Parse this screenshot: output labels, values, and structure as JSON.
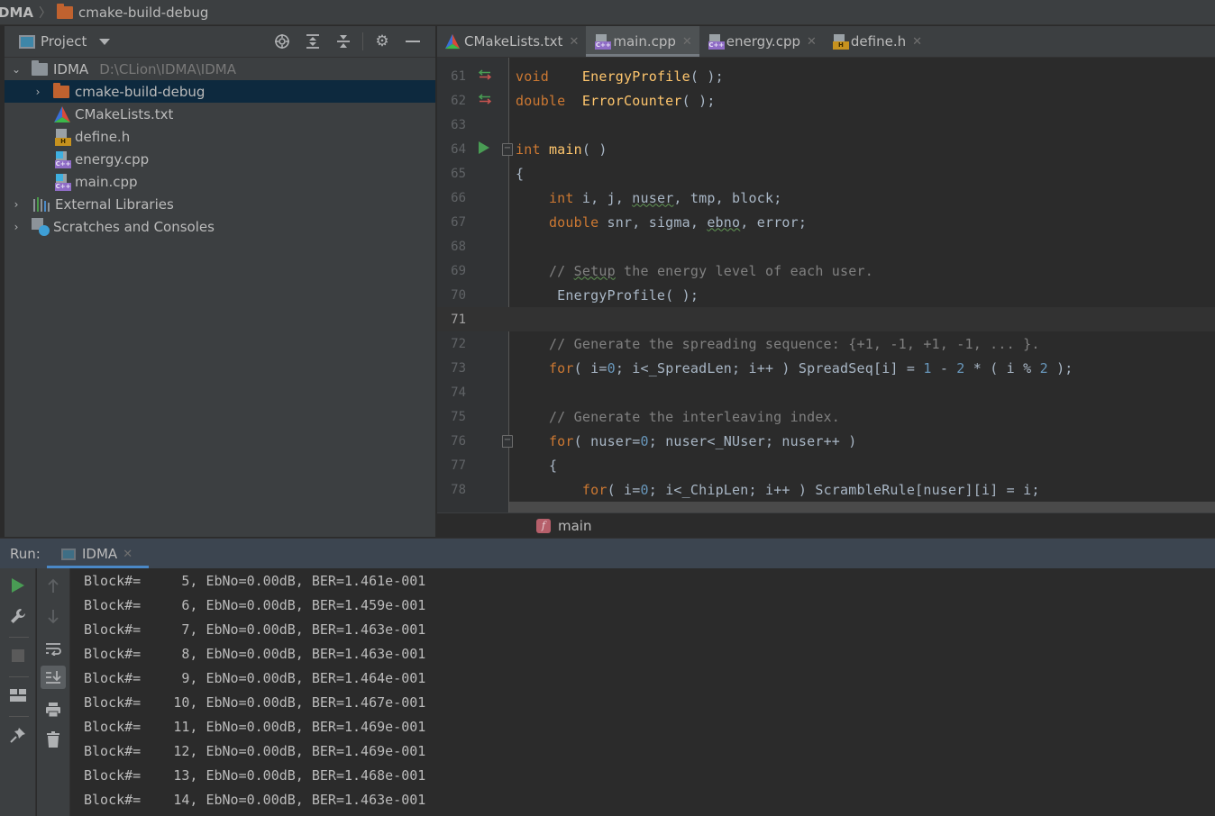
{
  "navbar": {
    "root": "DMA",
    "folder": "cmake-build-debug"
  },
  "project_panel": {
    "title": "Project",
    "tools": [
      "locate-icon",
      "expand-all-icon",
      "collapse-all-icon",
      "gear-icon",
      "minimize-icon"
    ],
    "tree": [
      {
        "label": "IDMA",
        "path": "D:\\CLion\\IDMA\\IDMA",
        "type": "folder",
        "expanded": true
      },
      {
        "label": "cmake-build-debug",
        "type": "folder-excluded",
        "selected": true
      },
      {
        "label": "CMakeLists.txt",
        "type": "cmake"
      },
      {
        "label": "define.h",
        "type": "header"
      },
      {
        "label": "energy.cpp",
        "type": "cpp"
      },
      {
        "label": "main.cpp",
        "type": "cpp"
      },
      {
        "label": "External Libraries",
        "type": "libraries"
      },
      {
        "label": "Scratches and Consoles",
        "type": "scratches"
      }
    ]
  },
  "editor_tabs": [
    {
      "label": "CMakeLists.txt",
      "type": "cmake",
      "active": false
    },
    {
      "label": "main.cpp",
      "type": "cpp",
      "active": true
    },
    {
      "label": "energy.cpp",
      "type": "cpp",
      "active": false
    },
    {
      "label": "define.h",
      "type": "header",
      "active": false
    }
  ],
  "editor": {
    "current_line": 71,
    "lines": [
      {
        "n": "61",
        "mark": "implementation-arrows"
      },
      {
        "n": "62",
        "mark": "implementation-arrows"
      },
      {
        "n": "63"
      },
      {
        "n": "64",
        "mark": "run"
      },
      {
        "n": "65"
      },
      {
        "n": "66"
      },
      {
        "n": "67"
      },
      {
        "n": "68"
      },
      {
        "n": "69"
      },
      {
        "n": "70"
      },
      {
        "n": "71"
      },
      {
        "n": "72"
      },
      {
        "n": "73"
      },
      {
        "n": "74"
      },
      {
        "n": "75"
      },
      {
        "n": "76"
      },
      {
        "n": "77"
      },
      {
        "n": "78"
      }
    ],
    "code": {
      "l61_kw": "void",
      "l61_fn": "EnergyProfile",
      "l61_rest": "( );",
      "l62_kw": "double",
      "l62_fn": "ErrorCounter",
      "l62_rest": "( );",
      "l64_kw": "int",
      "l64_fn": "main",
      "l64_rest": "( )",
      "l65": "{",
      "l66_kw": "int",
      "l66_a": " i, j, ",
      "l66_sq": "nuser",
      "l66_b": ", tmp, block;",
      "l67_kw": "double",
      "l67_a": " snr, sigma, ",
      "l67_sq": "ebno",
      "l67_b": ", error;",
      "l69_a": "// ",
      "l69_sq": "Setup",
      "l69_b": " the energy level of each user.",
      "l70": "EnergyProfile( );",
      "l72": "// Generate the spreading sequence: {+1, -1, +1, -1, ... }.",
      "l73_kw": "for",
      "l73_a": "( i=",
      "l73_n0": "0",
      "l73_b": "; i<_SpreadLen; i++ ) SpreadSeq[i] = ",
      "l73_n1": "1",
      "l73_c": " - ",
      "l73_n2": "2",
      "l73_d": " * ( i % ",
      "l73_n3": "2",
      "l73_e": " );",
      "l75": "// Generate the interleaving index.",
      "l76_kw": "for",
      "l76_a": "( nuser=",
      "l76_n0": "0",
      "l76_b": "; nuser<_NUser; nuser++ )",
      "l77": "{",
      "l78_kw": "for",
      "l78_a": "( i=",
      "l78_n0": "0",
      "l78_b": "; i<_ChipLen; i++ ) ScrambleRule[nuser][i] = i;"
    }
  },
  "breadcrumb": {
    "badge": "f",
    "label": "main"
  },
  "run_panel": {
    "title": "Run:",
    "tab_label": "IDMA",
    "console_lines": [
      "Block#=     5, EbNo=0.00dB, BER=1.461e-001",
      "Block#=     6, EbNo=0.00dB, BER=1.459e-001",
      "Block#=     7, EbNo=0.00dB, BER=1.463e-001",
      "Block#=     8, EbNo=0.00dB, BER=1.463e-001",
      "Block#=     9, EbNo=0.00dB, BER=1.464e-001",
      "Block#=    10, EbNo=0.00dB, BER=1.467e-001",
      "Block#=    11, EbNo=0.00dB, BER=1.469e-001",
      "Block#=    12, EbNo=0.00dB, BER=1.469e-001",
      "Block#=    13, EbNo=0.00dB, BER=1.468e-001",
      "Block#=    14, EbNo=0.00dB, BER=1.463e-001"
    ]
  },
  "colors": {
    "keyword": "#cc7832",
    "function": "#ffc66d",
    "comment": "#808080",
    "number": "#6897bb",
    "identifier": "#a9b7c6",
    "run_green": "#499c54",
    "selection": "#0d293e",
    "accent_blue": "#4a88c7"
  }
}
